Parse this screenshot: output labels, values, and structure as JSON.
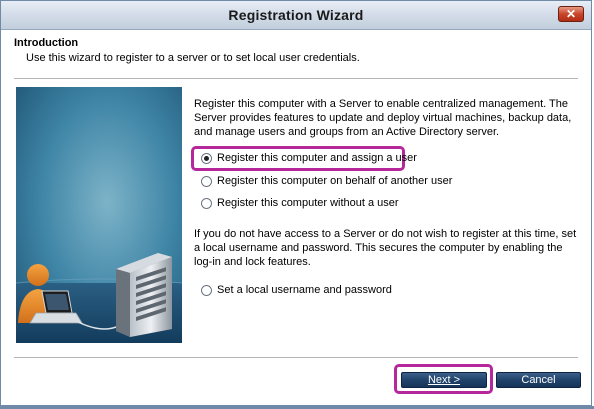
{
  "window": {
    "title": "Registration Wizard",
    "close_glyph": "✕"
  },
  "intro": {
    "heading": "Introduction",
    "text": "Use this wizard to register to a server or to set local user credentials."
  },
  "content": {
    "para1": "Register this computer with a Server to enable centralized management. The Server provides features to update and deploy virtual machines, backup data, and manage users and groups from an Active Directory server.",
    "options": [
      {
        "label": "Register this computer and assign a user",
        "checked": true
      },
      {
        "label": "Register this computer on behalf of another user",
        "checked": false
      },
      {
        "label": "Register this computer without a user",
        "checked": false
      }
    ],
    "para2": "If you do not have access to a Server or do not wish to register at this time, set a local username and password.  This secures the computer by enabling the log-in and lock features.",
    "local_option": {
      "label": "Set a local username and password",
      "checked": false
    }
  },
  "buttons": {
    "next": "Next >",
    "cancel": "Cancel"
  },
  "colors": {
    "highlight": "#b5279a",
    "button": "#21436b",
    "illustration_sky": "#2f6f8f"
  },
  "icons": {
    "close": "close-icon",
    "illustration": [
      "person-icon",
      "laptop-icon",
      "server-icon"
    ]
  }
}
